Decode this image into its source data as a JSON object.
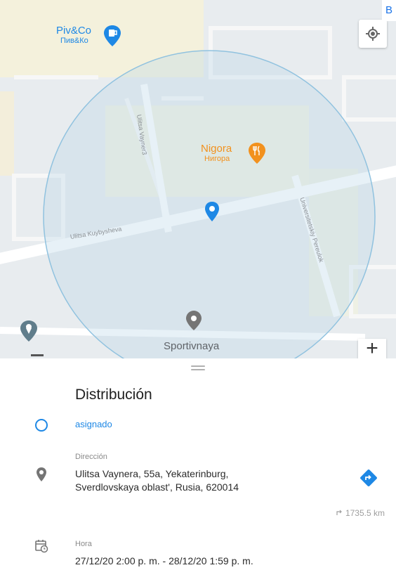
{
  "map": {
    "pois": [
      {
        "name": "Piv&Co",
        "alt": "Пив&Ко",
        "icon": "beer-mug-icon",
        "color": "#1e88e5"
      },
      {
        "name": "Nigora",
        "alt": "Нигора",
        "icon": "restaurant-icon",
        "color": "#f2911d"
      }
    ],
    "places": [
      {
        "name": "Sportivnaya",
        "icon": "place-pin-icon"
      }
    ],
    "streets": [
      "Ulitsa Vayner3",
      "Ulitsa Kuybysheva",
      "Universitetskiy Pereulok"
    ],
    "edge_chip": "B",
    "zoom_in_label": "+",
    "accent_color": "#1e88e5",
    "geofence_color": "#90c2df"
  },
  "sheet": {
    "title": "Distribución",
    "status": "asignado",
    "address": {
      "label": "Dirección",
      "line1": "Ulitsa Vaynera, 55a, Yekaterinburg,",
      "line2": "Sverdlovskaya oblast', Rusia, 620014"
    },
    "distance": "1735.5 km",
    "time": {
      "label": "Hora",
      "value": "27/12/20 2:00 p. m. - 28/12/20 1:59 p. m."
    }
  }
}
